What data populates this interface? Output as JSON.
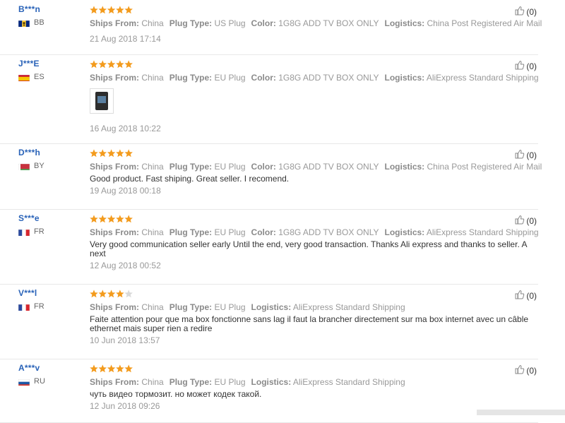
{
  "labels": {
    "ships_from": "Ships From:",
    "plug_type": "Plug Type:",
    "color": "Color:",
    "logistics": "Logistics:"
  },
  "reviews": [
    {
      "user": "B***n",
      "country": "BB",
      "rating": 5,
      "ships_from": "China",
      "plug_type": "US Plug",
      "color": "1G8G ADD TV BOX ONLY",
      "logistics": "China Post Registered Air Mail",
      "text": "",
      "date": "21 Aug 2018 17:14",
      "likes": "(0)"
    },
    {
      "user": "J***E",
      "country": "ES",
      "rating": 5,
      "ships_from": "China",
      "plug_type": "EU Plug",
      "color": "1G8G ADD TV BOX ONLY",
      "logistics": "AliExpress Standard Shipping",
      "text": "",
      "date": "16 Aug 2018 10:22",
      "likes": "(0)",
      "has_photo": true
    },
    {
      "user": "D***h",
      "country": "BY",
      "rating": 5,
      "ships_from": "China",
      "plug_type": "EU Plug",
      "color": "1G8G ADD TV BOX ONLY",
      "logistics": "China Post Registered Air Mail",
      "text": "Good product. Fast shiping. Great seller. I recomend.",
      "date": "19 Aug 2018 00:18",
      "likes": "(0)"
    },
    {
      "user": "S***e",
      "country": "FR",
      "rating": 5,
      "ships_from": "China",
      "plug_type": "EU Plug",
      "color": "1G8G ADD TV BOX ONLY",
      "logistics": "AliExpress Standard Shipping",
      "text": "Very good communication seller early Until the end, very good transaction. Thanks Ali express and thanks to seller. A next",
      "date": "12 Aug 2018 00:52",
      "likes": "(0)"
    },
    {
      "user": "V***l",
      "country": "FR",
      "rating": 4,
      "ships_from": "China",
      "plug_type": "EU Plug",
      "color": "",
      "logistics": "AliExpress Standard Shipping",
      "text": "Faite attention pour que ma box fonctionne sans lag il faut la brancher directement sur ma box internet avec un câble ethernet mais super rien a redire",
      "date": "10 Jun 2018 13:57",
      "likes": "(0)"
    },
    {
      "user": "A***v",
      "country": "RU",
      "rating": 5,
      "ships_from": "China",
      "plug_type": "EU Plug",
      "color": "",
      "logistics": "AliExpress Standard Shipping",
      "text": "чуть видео тормозит. но может кодек такой.",
      "date": "12 Jun 2018 09:26",
      "likes": "(0)"
    }
  ],
  "colors": {
    "star_filled": "#f39b1d",
    "star_empty": "#d9d9d9",
    "username": "#2a63b8"
  }
}
